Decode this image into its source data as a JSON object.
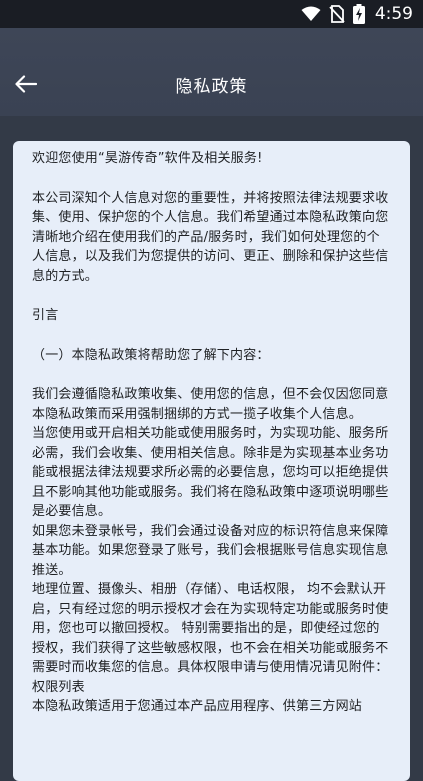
{
  "status_bar": {
    "time": "4:59",
    "icons": [
      "wifi-icon",
      "no-sim-icon",
      "battery-charging-icon"
    ]
  },
  "header": {
    "title": "隐私政策",
    "back_icon": "arrow-left-icon"
  },
  "policy": {
    "welcome": "欢迎您使用“昊游传奇”软件及相关服务!",
    "intro": "本公司深知个人信息对您的重要性，并将按照法律法规要求收集、使用、保护您的个人信息。我们希望通过本隐私政策向您清晰地介绍在使用我们的产品/服务时，我们如何处理您的个人信息，以及我们为您提供的访问、更正、删除和保护这些信息的方式。",
    "preface_heading": "引言",
    "section_heading": "（一）本隐私政策将帮助您了解下内容：",
    "para1": "我们会遵循隐私政策收集、使用您的信息，但不会仅因您同意本隐私政策而采用强制捆绑的方式一揽子收集个人信息。",
    "para2": "当您使用或开启相关功能或使用服务时，为实现功能、服务所必需，我们会收集、使用相关信息。除非是为实现基本业务功能或根据法律法规要求所必需的必要信息，您均可以拒绝提供且不影响其他功能或服务。我们将在隐私政策中逐项说明哪些是必要信息。",
    "para3": "如果您未登录帐号，我们会通过设备对应的标识符信息来保障基本功能。如果您登录了账号，我们会根据账号信息实现信息推送。",
    "para4": "地理位置、摄像头、相册（存储）、电话权限， 均不会默认开启，只有经过您的明示授权才会在为实现特定功能或服务时使用，您也可以撤回授权。 特别需要指出的是，即使经过您的授权，我们获得了这些敏感权限，也不会在相关功能或服务不需要时而收集您的信息。具体权限申请与使用情况请见附件：权限列表",
    "para5": "本隐私政策适用于您通过本产品应用程序、供第三方网站"
  }
}
